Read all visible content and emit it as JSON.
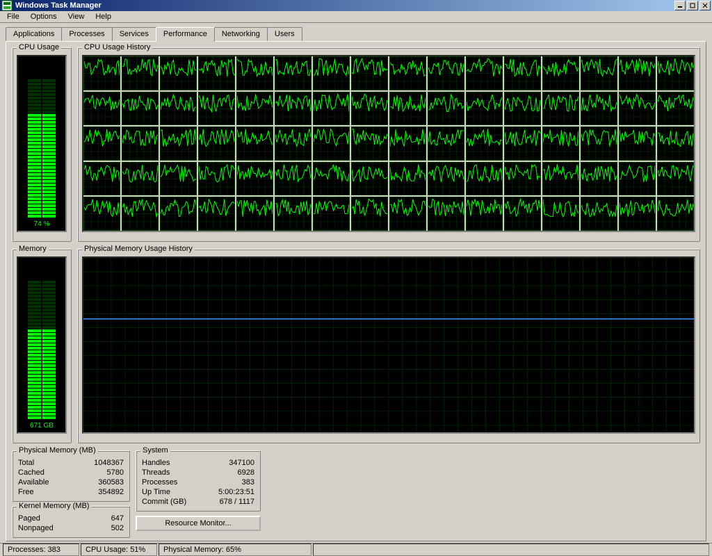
{
  "window": {
    "title": "Windows Task Manager"
  },
  "menu": {
    "file": "File",
    "options": "Options",
    "view": "View",
    "help": "Help"
  },
  "tabs": {
    "applications": "Applications",
    "processes": "Processes",
    "services": "Services",
    "performance": "Performance",
    "networking": "Networking",
    "users": "Users"
  },
  "groups": {
    "cpu_usage": "CPU Usage",
    "cpu_history": "CPU Usage History",
    "memory": "Memory",
    "mem_history": "Physical Memory Usage History",
    "phys_mem": "Physical Memory (MB)",
    "kernel_mem": "Kernel Memory (MB)",
    "system": "System"
  },
  "gauges": {
    "cpu_value": "74 %",
    "mem_value": "671 GB"
  },
  "phys_mem": {
    "total_label": "Total",
    "total_val": "1048367",
    "cached_label": "Cached",
    "cached_val": "5780",
    "available_label": "Available",
    "available_val": "360583",
    "free_label": "Free",
    "free_val": "354892"
  },
  "kernel_mem": {
    "paged_label": "Paged",
    "paged_val": "647",
    "nonpaged_label": "Nonpaged",
    "nonpaged_val": "502"
  },
  "system": {
    "handles_label": "Handles",
    "handles_val": "347100",
    "threads_label": "Threads",
    "threads_val": "6928",
    "processes_label": "Processes",
    "processes_val": "383",
    "uptime_label": "Up Time",
    "uptime_val": "5:00:23:51",
    "commit_label": "Commit (GB)",
    "commit_val": "678 / 1117"
  },
  "buttons": {
    "resource_monitor": "Resource Monitor..."
  },
  "status": {
    "processes": "Processes: 383",
    "cpu": "CPU Usage: 51%",
    "mem": "Physical Memory: 65%"
  },
  "chart_data": {
    "cpu_gauge": {
      "type": "bar",
      "value_percent": 74,
      "label": "74 %"
    },
    "cpu_history": {
      "type": "line",
      "description": "80 small line charts (16 columns × 5 rows) each showing one logical CPU's usage over time",
      "core_count": 80,
      "y_range": [
        0,
        100
      ],
      "typical_range_percent": [
        40,
        95
      ]
    },
    "memory_gauge": {
      "type": "bar",
      "value_gb": 671,
      "total_gb_approx": 1024,
      "percent_approx": 65,
      "label": "671 GB"
    },
    "memory_history": {
      "type": "line",
      "series": [
        {
          "name": "Physical Memory Used",
          "approx_constant_percent": 65
        }
      ],
      "y_range": [
        0,
        100
      ]
    }
  }
}
